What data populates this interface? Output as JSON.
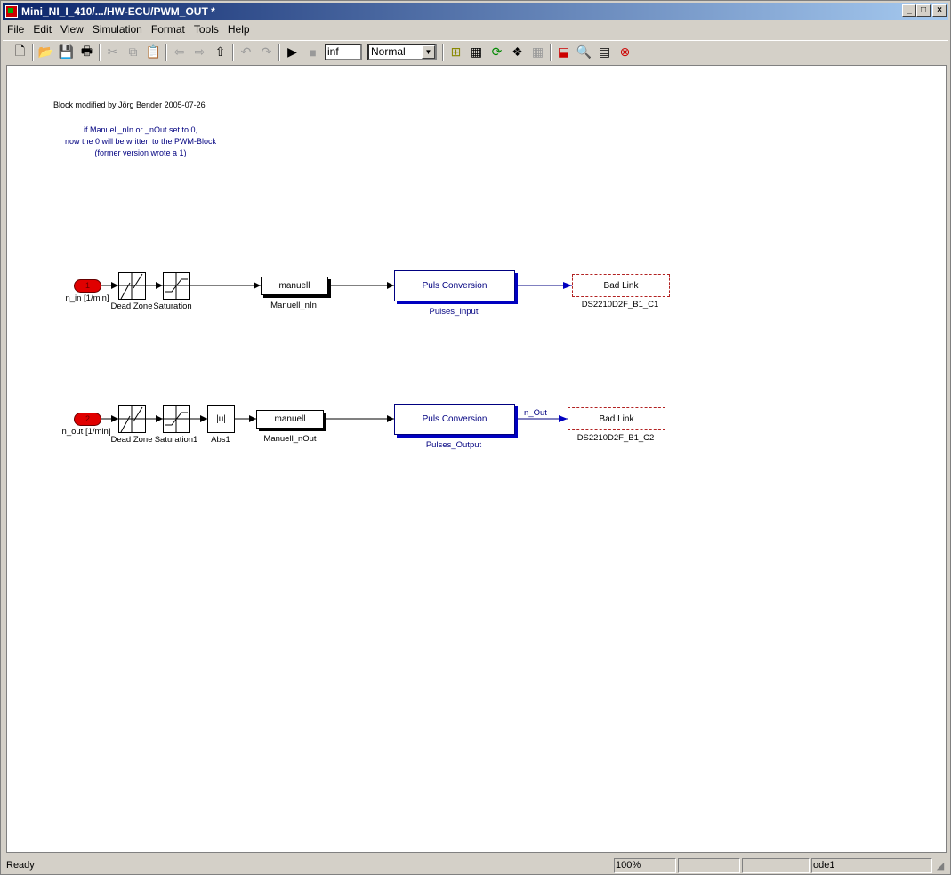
{
  "window": {
    "title": "Mini_NI_I_410/.../HW-ECU/PWM_OUT *"
  },
  "menu": [
    "File",
    "Edit",
    "View",
    "Simulation",
    "Format",
    "Tools",
    "Help"
  ],
  "toolbar": {
    "stop_time": "inf",
    "sim_mode": "Normal"
  },
  "annotations": {
    "modified": "Block modified by Jörg Bender 2005-07-26",
    "note1": "if Manuell_nIn or _nOut set to 0,",
    "note2": "now the 0 will be written to the PWM-Block",
    "note3": "(former version wrote a 1)"
  },
  "row1": {
    "port_num": "1",
    "port_label": "n_in [1/min]",
    "deadzone": "Dead Zone",
    "saturation": "Saturation",
    "manuell_text": "manuell",
    "manuell_label": "Manuell_nIn",
    "puls_text": "Puls Conversion",
    "puls_label": "Pulses_Input",
    "badlink_text": "Bad Link",
    "badlink_label": "DS2210D2F_B1_C1"
  },
  "row2": {
    "port_num": "2",
    "port_label": "n_out [1/min]",
    "deadzone": "Dead Zone",
    "saturation": "Saturation1",
    "abs_text": "|u|",
    "abs_label": "Abs1",
    "manuell_text": "manuell",
    "manuell_label": "Manuell_nOut",
    "puls_text": "Puls Conversion",
    "puls_label": "Pulses_Output",
    "signal": "n_Out",
    "badlink_text": "Bad Link",
    "badlink_label": "DS2210D2F_B1_C2"
  },
  "status": {
    "text": "Ready",
    "zoom": "100%",
    "cell2": "",
    "cell3": "",
    "solver": "ode1"
  },
  "colors": {
    "title_start": "#0a246a",
    "title_end": "#a6caf0",
    "blue_block": "#000080",
    "bad_link": "#b22222",
    "port": "#e00000"
  }
}
